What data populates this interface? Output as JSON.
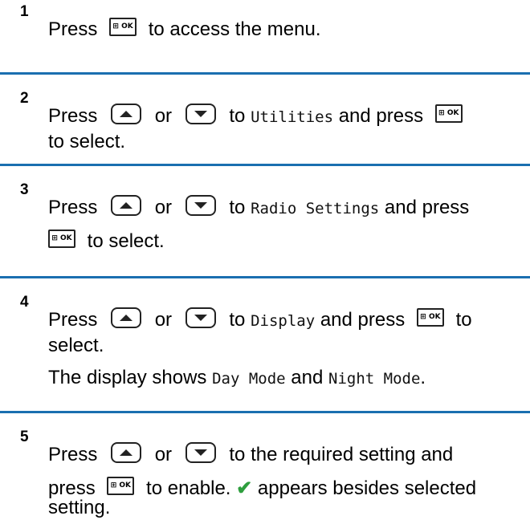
{
  "steps": [
    {
      "number": "1",
      "lines": [
        {
          "press": "Press",
          "key": "ok",
          "after": "to access the menu."
        }
      ]
    },
    {
      "number": "2",
      "press": "Press",
      "or": "or",
      "to": "to",
      "target": "Utilities",
      "and_press": "and press",
      "to_select": "to select."
    },
    {
      "number": "3",
      "press": "Press",
      "or": "or",
      "to": "to",
      "target": "Radio Settings",
      "and_press": "and press",
      "to_select": "to select."
    },
    {
      "number": "4",
      "press": "Press",
      "or": "or",
      "to": "to",
      "target": "Display",
      "and_press": "and press",
      "to_word": "to",
      "select": "select.",
      "result_prefix": "The display shows",
      "result_mode1": "Day Mode",
      "result_and": "and",
      "result_mode2": "Night Mode",
      "result_end": "."
    },
    {
      "number": "5",
      "press": "Press",
      "or": "or",
      "after_nav": "to the required setting and",
      "press2": "press",
      "to_enable": "to enable.",
      "check_glyph": "✔",
      "appears": "appears besides selected",
      "setting": "setting."
    }
  ],
  "keys": {
    "ok_label": "OK",
    "ok_icon": "menu-grid-icon",
    "up_icon": "up-arrow-icon",
    "down_icon": "down-arrow-icon"
  },
  "colors": {
    "divider": "#1a6fb0",
    "check": "#2e9e3e"
  }
}
